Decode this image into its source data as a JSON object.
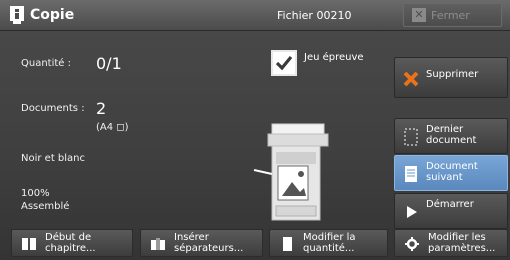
{
  "header": {
    "title": "Copie",
    "file_name": "Fichier 00210",
    "close_label": "Fermer"
  },
  "status": {
    "quantity_label": "Quantité :",
    "quantity_value": "0/1",
    "documents_label": "Documents :",
    "documents_value": "2",
    "paper_size": "(A4 ◻)",
    "color_mode": "Noir et blanc",
    "zoom": "100%",
    "collation": "Assemblé"
  },
  "proof": {
    "label": "Jeu épreuve",
    "checked": true
  },
  "actions": {
    "delete": "Supprimer",
    "last_doc_1": "Dernier",
    "last_doc_2": "document",
    "next_doc_1": "Document",
    "next_doc_2": "suivant",
    "start": "Démarrer"
  },
  "bottom": {
    "chapter_1": "Début de",
    "chapter_2": "chapitre...",
    "separators_1": "Insérer",
    "separators_2": "séparateurs...",
    "quantity_1": "Modifier la",
    "quantity_2": "quantité...",
    "params_1": "Modifier les",
    "params_2": "paramètres..."
  },
  "colors": {
    "selected_button": "#6a98cc",
    "delete_icon": "#e8731a"
  }
}
